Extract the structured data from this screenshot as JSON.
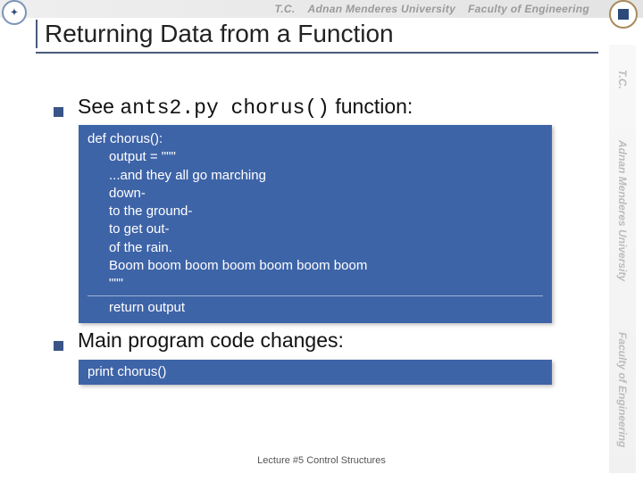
{
  "header": {
    "tc": "T.C.",
    "univ": "Adnan Menderes University",
    "fac": "Faculty of Engineering"
  },
  "side": {
    "tc": "T.C.",
    "univ": "Adnan Menderes University",
    "fac": "Faculty of Engineering"
  },
  "title": "Returning Data from a Function",
  "bullet1": {
    "pre": "See ",
    "code1": "ants2.py",
    "code2": " chorus()",
    "post": " function:"
  },
  "code1": {
    "l1": "def chorus():",
    "l2": "output = \"\"\"",
    "l3": "...and they all go marching",
    "l4": "down-",
    "l5": "to the ground-",
    "l6": "to get out-",
    "l7": "of the rain.",
    "l8": "Boom boom boom boom boom boom boom",
    "l9": "\"\"\"",
    "l10": "return output"
  },
  "bullet2": "Main program code changes:",
  "code2": {
    "l1": "print chorus()"
  },
  "footer": "Lecture #5 Control Structures"
}
